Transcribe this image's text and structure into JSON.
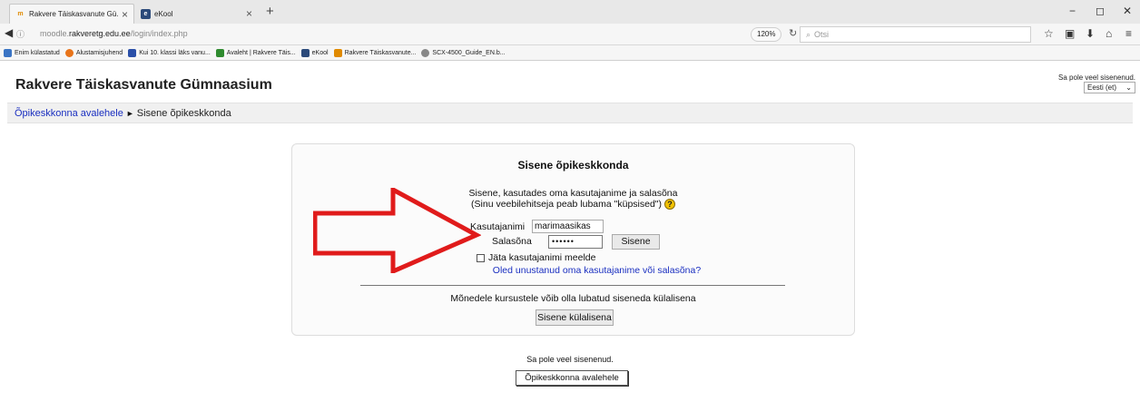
{
  "browser": {
    "tabs": [
      {
        "label": "Rakvere Täiskasvanute Gü...",
        "icon": "moodle-icon"
      },
      {
        "label": "eKool",
        "icon": "ekool-icon"
      }
    ],
    "new_tab": "+",
    "url_prefix": "moodle.",
    "url_domain": "rakveretg.edu.ee",
    "url_path": "/login/index.php",
    "zoom": "120%",
    "search_placeholder": "Otsi",
    "bookmarks": [
      {
        "label": "Enim külastatud",
        "color": "#3a74c4"
      },
      {
        "label": "Alustamisjuhend",
        "color": "#e8741a"
      },
      {
        "label": "Kui 10. klassi läks vanu...",
        "color": "#2a4fa8"
      },
      {
        "label": "Avaleht | Rakvere Täis...",
        "color": "#2f8b2f"
      },
      {
        "label": "eKool",
        "color": "#2b4a7a"
      },
      {
        "label": "Rakvere Täiskasvanute...",
        "color": "#e08a00"
      },
      {
        "label": "SCX-4500_Guide_EN.b...",
        "color": "#888888"
      }
    ]
  },
  "header": {
    "site_title": "Rakvere Täiskasvanute Gümnaasium",
    "login_status": "Sa pole veel sisenenud.",
    "language": "Eesti (et)"
  },
  "breadcrumb": {
    "home": "Õpikeskkonna avalehele",
    "separator": "►",
    "current": "Sisene õpikeskkonda"
  },
  "login": {
    "heading": "Sisene õpikeskkonda",
    "desc_line1": "Sisene, kasutades oma kasutajanime ja salasõna",
    "desc_line2": "(Sinu veebilehitseja peab lubama \"küpsised\")",
    "help_glyph": "?",
    "username_label": "Kasutajanimi",
    "username_value": "marimaasikas",
    "password_label": "Salasõna",
    "password_value": "••••••",
    "login_button": "Sisene",
    "remember_label": "Jäta kasutajanimi meelde",
    "forgot_link": "Oled unustanud oma kasutajanime või salasõna?",
    "guest_note": "Mõnedele kursustele võib olla lubatud siseneda külalisena",
    "guest_button": "Sisene külalisena"
  },
  "footer": {
    "status": "Sa pole veel sisenenud.",
    "home_button": "Õpikeskkonna avalehele"
  },
  "annotation": {
    "arrow_color": "#e01b1b"
  }
}
